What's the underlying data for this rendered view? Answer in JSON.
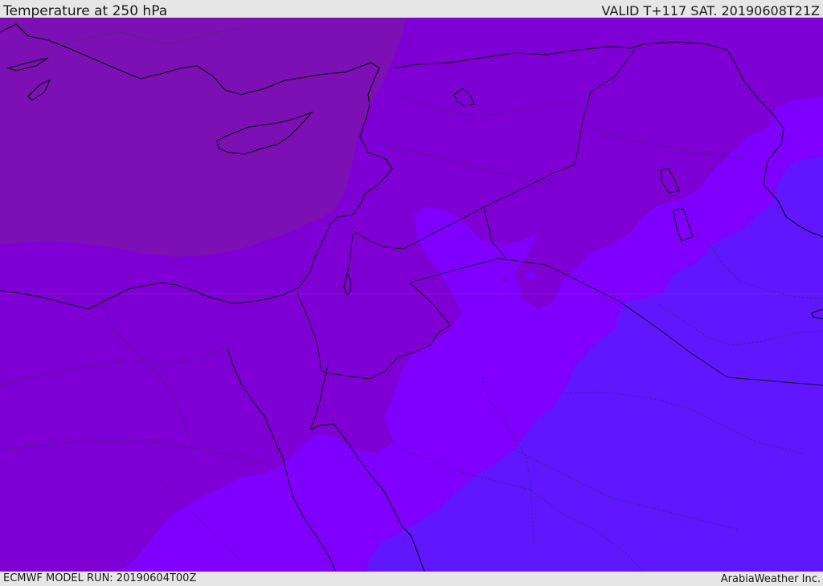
{
  "header": {
    "title": "Temperature at 250 hPa",
    "valid": "VALID T+117 SAT. 20190608T21Z"
  },
  "footer": {
    "model_run": "ECMWF MODEL RUN: 20190604T00Z",
    "credit": "ArabiaWeather Inc."
  },
  "map": {
    "colors": {
      "mediterranean_band": "#7c10b4",
      "warm_band": "#7f00d4",
      "mid_band": "#8000ff",
      "cool_band": "#6016ff",
      "coastline": "#000000",
      "border": "#333333"
    }
  }
}
